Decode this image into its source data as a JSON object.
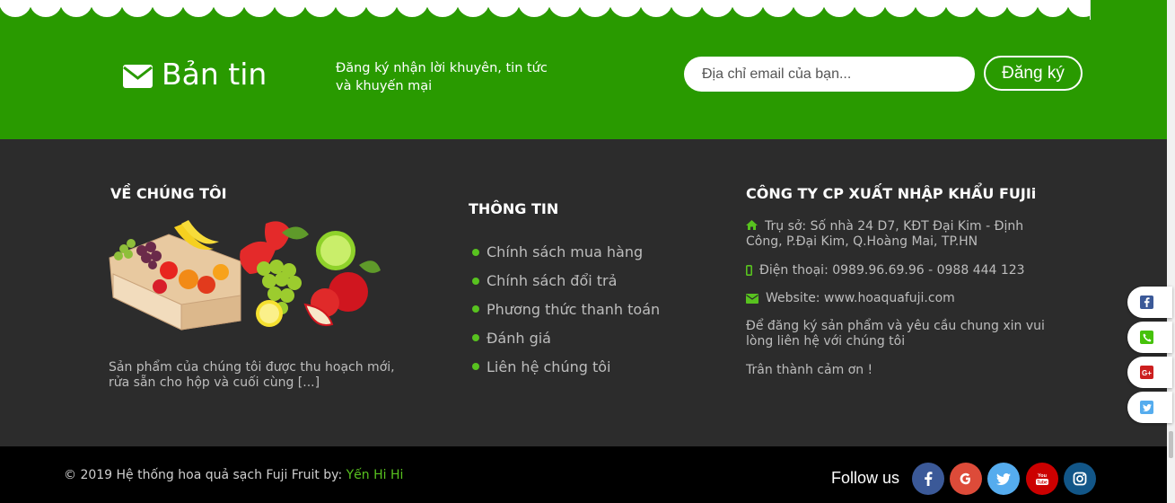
{
  "colors": {
    "green": "#299A00",
    "footer_bg": "#2c2c2c",
    "bottom_bg": "#000000",
    "accent": "#58c21f",
    "facebook": "#3b5998",
    "google": "#dd4b39",
    "twitter": "#55acee",
    "youtube": "#cc0000",
    "instagram": "#125688"
  },
  "newsletter": {
    "icon": "envelope-icon",
    "title": "Bản tin",
    "description": "Đăng ký nhận lời khuyên, tin tức và khuyến mại",
    "email_placeholder": "Địa chỉ email của bạn...",
    "email_value": "",
    "subscribe_label": "Đăng ký"
  },
  "about": {
    "title": "VỀ CHÚNG TÔI",
    "image": "fruit-basket-image",
    "text": "Sản phẩm của chúng tôi được thu hoạch mới, rửa sẵn cho hộp và cuối cùng [...]"
  },
  "info": {
    "title": "THÔNG TIN",
    "links": [
      "Chính sách mua hàng",
      "Chính sách đổi trả",
      "Phương thức thanh toán",
      "Đánh giá",
      "Liên hệ chúng tôi"
    ]
  },
  "company": {
    "title": "CÔNG TY CP XUẤT NHẬP KHẨU FUJIi",
    "address": "Trụ sở: Số nhà 24 D7, KĐT Đại Kim - Định Công, P.Đại Kim, Q.Hoàng Mai, TP.HN",
    "phone": "Điện thoại: 0989.96.69.96 - 0988 444 123",
    "website": "Website: www.hoaquafuji.com",
    "contact_note": "Để đăng ký sản phẩm và yêu cầu chung xin vui lòng liên hệ với chúng tôi",
    "thanks": "Trân thành cảm ơn !"
  },
  "bottom": {
    "copyright": "© 2019 Hệ thống hoa quả sạch Fuji Fruit by: ",
    "author": "Yến Hi Hi",
    "follow_label": "Follow us",
    "social": [
      "facebook-icon",
      "google-plus-icon",
      "twitter-icon",
      "youtube-icon",
      "instagram-icon"
    ]
  },
  "floating_share": [
    "facebook-icon",
    "phone-icon",
    "google-plus-icon",
    "twitter-icon"
  ]
}
